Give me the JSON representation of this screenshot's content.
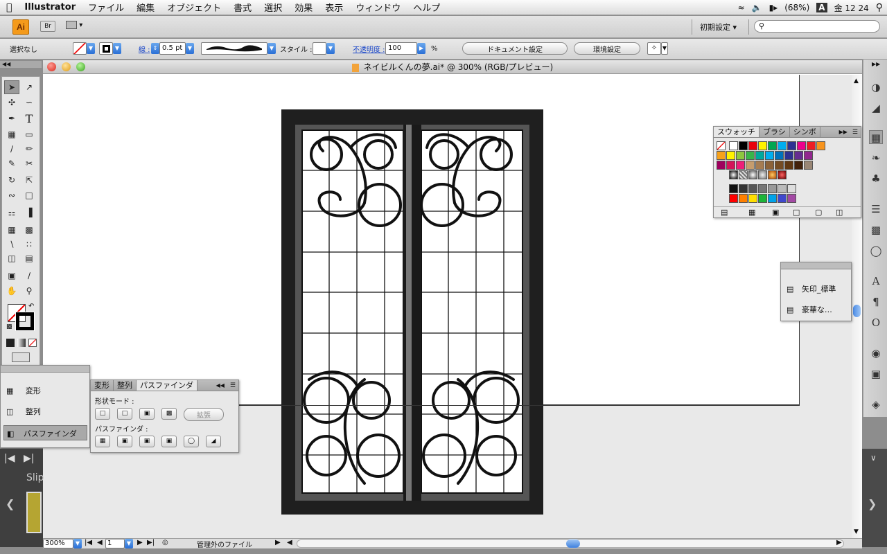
{
  "menubar": {
    "apple": "",
    "app": "Illustrator",
    "items": [
      "ファイル",
      "編集",
      "オブジェクト",
      "書式",
      "選択",
      "効果",
      "表示",
      "ウィンドウ",
      "ヘルプ"
    ],
    "battery": "(68%)",
    "input_indicator": "A",
    "clock": "金 12 24"
  },
  "appbar": {
    "ai_label": "Ai",
    "br_label": "Br",
    "workspace": "初期設定 ▾"
  },
  "control": {
    "selection": "選択なし",
    "stroke_label": "線 :",
    "stroke_weight": "0.5 pt",
    "style_label": "スタイル :",
    "opacity_label": "不透明度 :",
    "opacity_value": "100",
    "percent": "%",
    "doc_setup": "ドキュメント設定",
    "preferences": "環境設定"
  },
  "document": {
    "title": "ネイビルくんの夢.ai* @ 300% (RGB/プレビュー)"
  },
  "swatches": {
    "tabs": [
      "スウォッチ",
      "ブラシ",
      "シンボ"
    ],
    "row1": [
      "#ffffff",
      "#000000",
      "#e8000b",
      "#fff200",
      "#00a650",
      "#00aeef",
      "#2e3192",
      "#ec008c",
      "#ed1c24",
      "#f7941d"
    ],
    "row2": [
      "#f7a21b",
      "#fff200",
      "#8dc63f",
      "#39b54a",
      "#00a99d",
      "#00aeef",
      "#0072bc",
      "#2e3192",
      "#662d91",
      "#92278f"
    ],
    "row3": [
      "#9e005d",
      "#d4145a",
      "#ed1e79",
      "#c69c6d",
      "#a67c52",
      "#8c6239",
      "#754c24",
      "#603813",
      "#42210b",
      "#998675"
    ],
    "gray_row": [
      "#111111",
      "#333333",
      "#555555",
      "#777777",
      "#999999",
      "#bbbbbb",
      "#dddddd"
    ],
    "bright_row": [
      "#ff0000",
      "#ff7f00",
      "#ffde00",
      "#1eb53a",
      "#00a2e8",
      "#3f48cc",
      "#a349a4"
    ]
  },
  "brushpanel": {
    "items": [
      "矢印_標準",
      "豪華な…"
    ]
  },
  "transformpanel": {
    "items": [
      "変形",
      "整列",
      "パスファインダ"
    ]
  },
  "pathfinder": {
    "tabs": [
      "変形",
      "整列",
      "パスファインダ"
    ],
    "shape_mode": "形状モード :",
    "expand": "拡張",
    "pathfinder_label": "パスファインダ :"
  },
  "statusbar": {
    "zoom": "300%",
    "page": "1",
    "status": "管理外のファイル"
  },
  "slip": {
    "label": "Slip"
  }
}
